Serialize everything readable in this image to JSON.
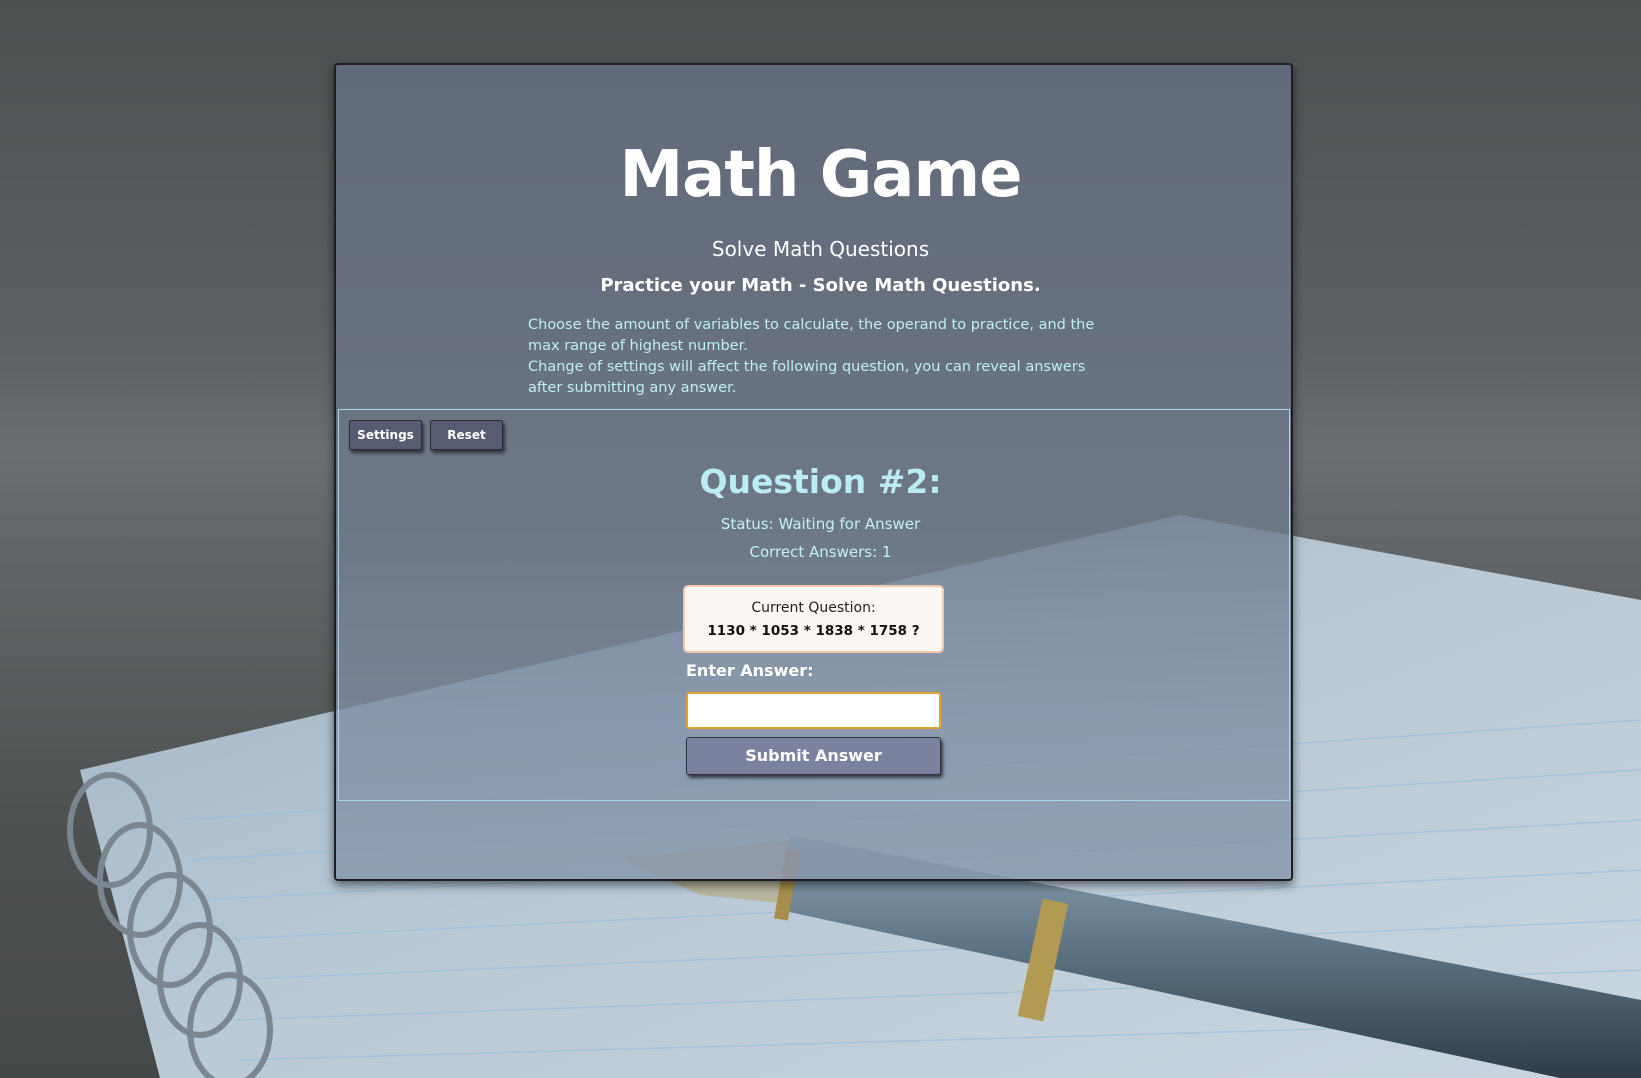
{
  "header": {
    "title": "Math Game",
    "subtitle": "Solve Math Questions",
    "tagline": "Practice your Math - Solve Math Questions.",
    "description_line1": "Choose the amount of variables to calculate, the operand to practice, and the max range of highest number.",
    "description_line2": "Change of settings will affect the following question, you can reveal answers after submitting any answer."
  },
  "toolbar": {
    "settings_label": "Settings",
    "reset_label": "Reset"
  },
  "game": {
    "question_heading": "Question #2:",
    "status": "Status: Waiting for Answer",
    "correct_answers": "Correct Answers: 1",
    "current_question_label": "Current Question:",
    "current_question": "1130 * 1053 * 1838 * 1758 ?",
    "enter_answer_label": "Enter Answer:",
    "answer_value": "",
    "submit_label": "Submit Answer"
  },
  "colors": {
    "accent_text": "#b9ecf3",
    "input_border": "#e1a52c",
    "button_bg": "#575c73",
    "submit_bg": "#7b829f"
  }
}
